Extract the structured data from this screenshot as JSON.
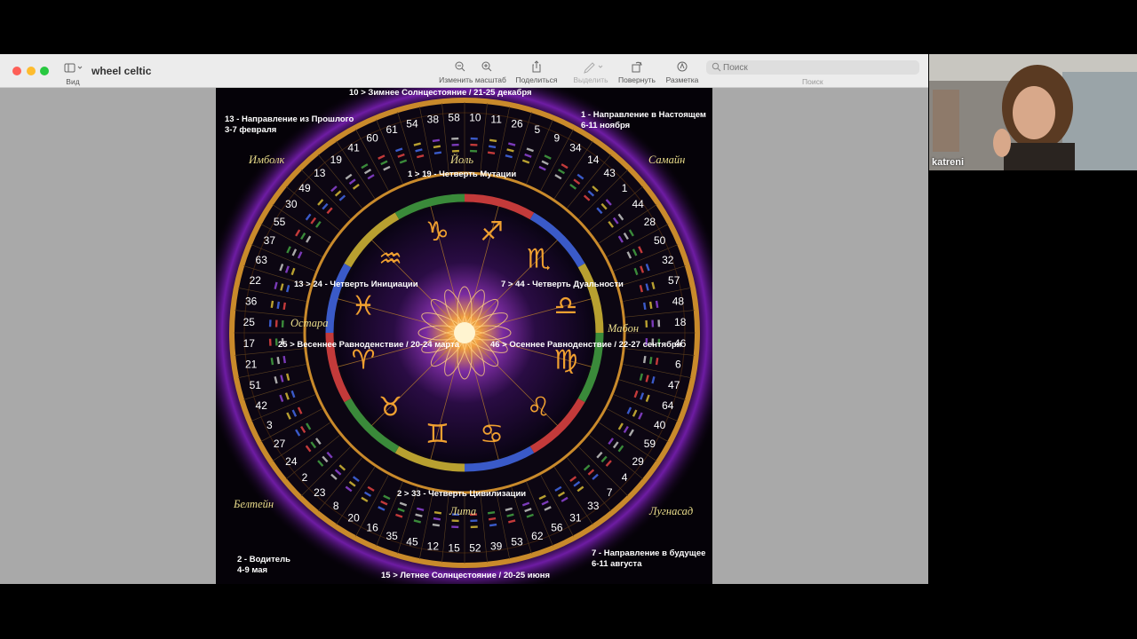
{
  "window": {
    "title": "wheel celtic",
    "view_label": "Вид"
  },
  "toolbar": {
    "zoom_label": "Изменить масштаб",
    "share_label": "Поделиться",
    "highlight_label": "Выделить",
    "rotate_label": "Повернуть",
    "markup_label": "Разметка",
    "search_placeholder": "Поиск",
    "search_label": "Поиск",
    "icons": [
      "sidebar-icon",
      "zoom-out-icon",
      "zoom-in-icon",
      "share-icon",
      "highlight-pen-icon",
      "rotate-icon",
      "markup-icon",
      "search-icon"
    ]
  },
  "wheel": {
    "annotations": {
      "top": "10 > Зимнее Солнцестояние /  21-25 декабря",
      "top_left_1": "13 - Направление из Прошлого",
      "top_left_2": "3-7 февраля",
      "top_right_1": "1 - Направление в Настоящем",
      "top_right_2": "6-11 ноября",
      "bottom_left_1": "2 - Водитель",
      "bottom_left_2": "4-9 мая",
      "bottom_right_1": "7 - Направление в будущее",
      "bottom_right_2": "6-11 августа",
      "bottom": "15 > Летнее Солнцестояние /  20-25 июня"
    },
    "festivals": {
      "imbolc": "Имболк",
      "yule": "Йоль",
      "samhain": "Самайн",
      "ostara": "Остара",
      "mabon": "Мабон",
      "beltane": "Белтейн",
      "litha": "Лита",
      "lughnasadh": "Лугнасад"
    },
    "quarters": {
      "mutation": "1 > 19 - Четверть Мутации",
      "initiation": "13 > 24 - Четверть Инициации",
      "duality": "7 > 44 - Четверть Дуальности",
      "civilization": "2 > 33 - Четверть Цивилизации",
      "spring": "25 > Весеннее Равноденствие /  20-24 марта",
      "autumn": "46 > Осеннее Равноденствие / 22-27 сентября"
    },
    "gate_numbers": [
      "10",
      "11",
      "26",
      "5",
      "9",
      "34",
      "14",
      "43",
      "1",
      "44",
      "28",
      "50",
      "32",
      "57",
      "48",
      "18",
      "46",
      "6",
      "47",
      "64",
      "40",
      "59",
      "29",
      "4",
      "7",
      "33",
      "31",
      "56",
      "62",
      "53",
      "39",
      "52",
      "15",
      "12",
      "45",
      "35",
      "16",
      "20",
      "8",
      "23",
      "2",
      "24",
      "27",
      "3",
      "42",
      "51",
      "21",
      "17",
      "25",
      "36",
      "22",
      "63",
      "37",
      "55",
      "30",
      "49",
      "13",
      "19",
      "41",
      "60",
      "61",
      "54",
      "38",
      "58"
    ],
    "zodiac": [
      "♑",
      "♐",
      "♏",
      "♎",
      "♍",
      "♌",
      "♋",
      "♊",
      "♉",
      "♈",
      "♓",
      "♒"
    ]
  },
  "video": {
    "participant": "katreni"
  },
  "colors": {
    "ring_gold": "#c98a2b",
    "purple_glow": "#7a1fb5",
    "zodiac_orange": "#f0a030",
    "festival_yellow": "#e9dc8a"
  }
}
